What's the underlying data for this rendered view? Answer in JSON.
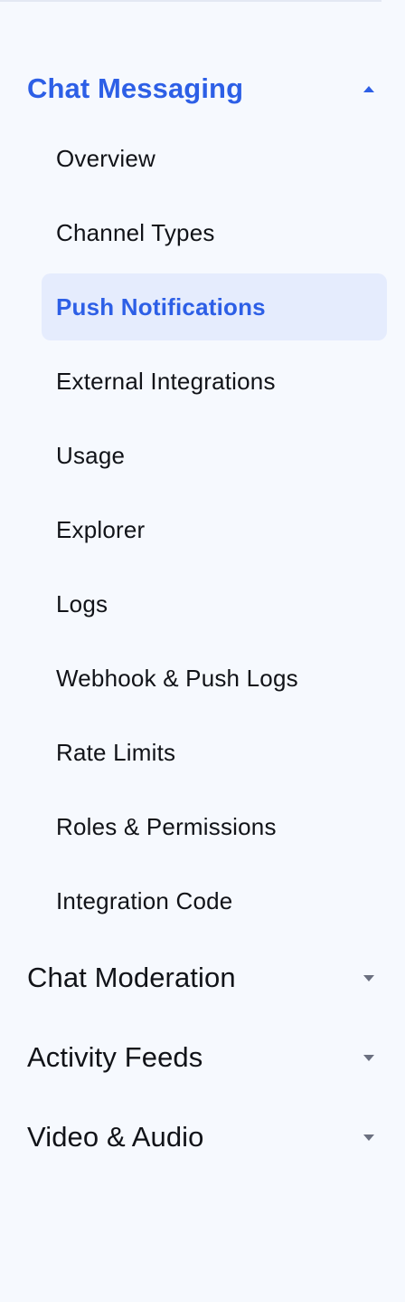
{
  "sidebar": {
    "sections": [
      {
        "label": "Chat Messaging",
        "expanded": true,
        "items": [
          {
            "label": "Overview"
          },
          {
            "label": "Channel Types"
          },
          {
            "label": "Push Notifications",
            "selected": true
          },
          {
            "label": "External Integrations"
          },
          {
            "label": "Usage"
          },
          {
            "label": "Explorer"
          },
          {
            "label": "Logs"
          },
          {
            "label": "Webhook & Push Logs"
          },
          {
            "label": "Rate Limits"
          },
          {
            "label": "Roles & Permissions"
          },
          {
            "label": "Integration Code"
          }
        ]
      },
      {
        "label": "Chat Moderation",
        "expanded": false
      },
      {
        "label": "Activity Feeds",
        "expanded": false
      },
      {
        "label": "Video & Audio",
        "expanded": false
      }
    ]
  },
  "colors": {
    "background": "#f6f9fe",
    "accent": "#2d5fe6",
    "selected_background": "#e5ecfd",
    "text": "#111318",
    "caret_collapsed": "#6b7080"
  },
  "icons": {
    "expanded": "caret-up-icon",
    "collapsed": "caret-down-icon"
  }
}
